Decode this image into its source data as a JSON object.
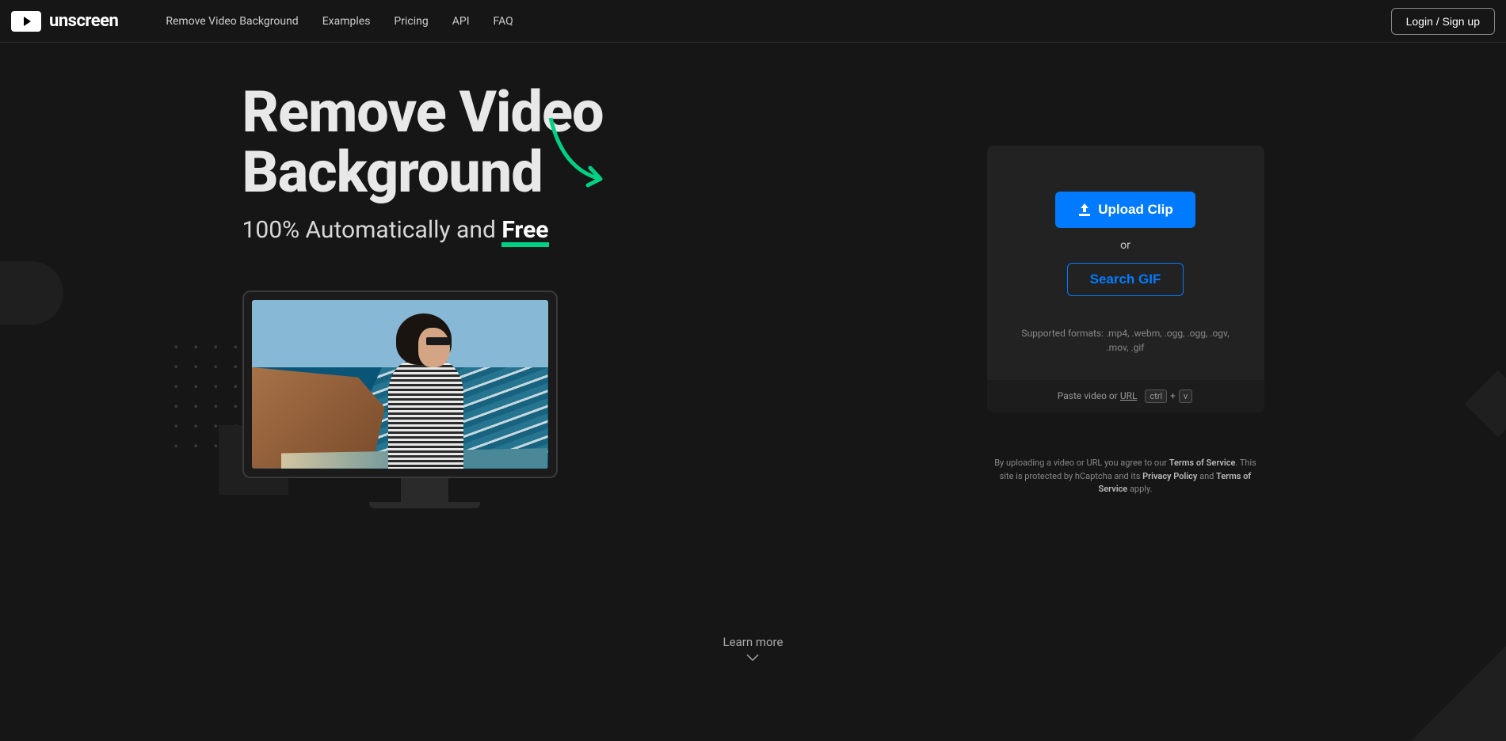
{
  "brand": {
    "name": "unscreen"
  },
  "nav": {
    "items": [
      "Remove Video Background",
      "Examples",
      "Pricing",
      "API",
      "FAQ"
    ],
    "login": "Login / Sign up"
  },
  "hero": {
    "title_line1": "Remove Video",
    "title_line2": "Background",
    "sub_prefix": "100% Automatically and ",
    "sub_free": "Free"
  },
  "upload": {
    "upload_label": "Upload Clip",
    "or": "or",
    "search_label": "Search GIF",
    "formats": "Supported formats: .mp4, .webm, .ogg, .ogg, .ogv, .mov, .gif",
    "paste_prefix": "Paste video or ",
    "url": "URL",
    "kbd1": "ctrl",
    "plus": " + ",
    "kbd2": "v"
  },
  "legal": {
    "t1": "By uploading a video or URL you agree to our ",
    "tos": "Terms of Service",
    "t2": ". This site is protected by hCaptcha and its ",
    "pp": "Privacy Policy",
    "t3": " and ",
    "tos2": "Terms of Service",
    "t4": " apply."
  },
  "learn_more": "Learn more",
  "colors": {
    "primary": "#007bff",
    "accent": "#00d084"
  }
}
